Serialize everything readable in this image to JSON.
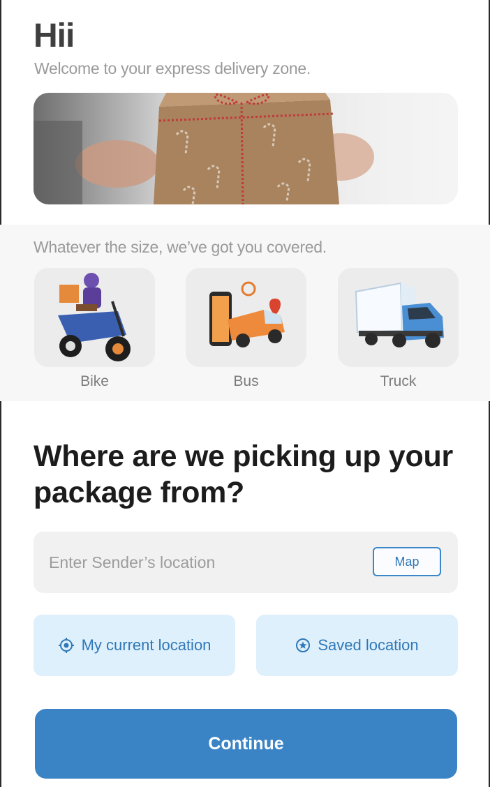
{
  "header": {
    "greeting": "Hii",
    "subtitle": "Welcome to your express delivery zone."
  },
  "vehicles": {
    "title": "Whatever the size, we’ve got you covered.",
    "items": [
      {
        "label": "Bike",
        "icon": "scooter-rider-icon"
      },
      {
        "label": "Bus",
        "icon": "delivery-van-icon"
      },
      {
        "label": "Truck",
        "icon": "truck-icon"
      }
    ]
  },
  "pickup": {
    "question": "Where are we picking up your package from?",
    "search_placeholder": "Enter Sender’s location",
    "map_label": "Map",
    "current_location_label": "My current location",
    "saved_location_label": "Saved location"
  },
  "footer": {
    "continue_label": "Continue"
  },
  "colors": {
    "accent": "#3a84c6",
    "accent_light": "#def0fc"
  }
}
